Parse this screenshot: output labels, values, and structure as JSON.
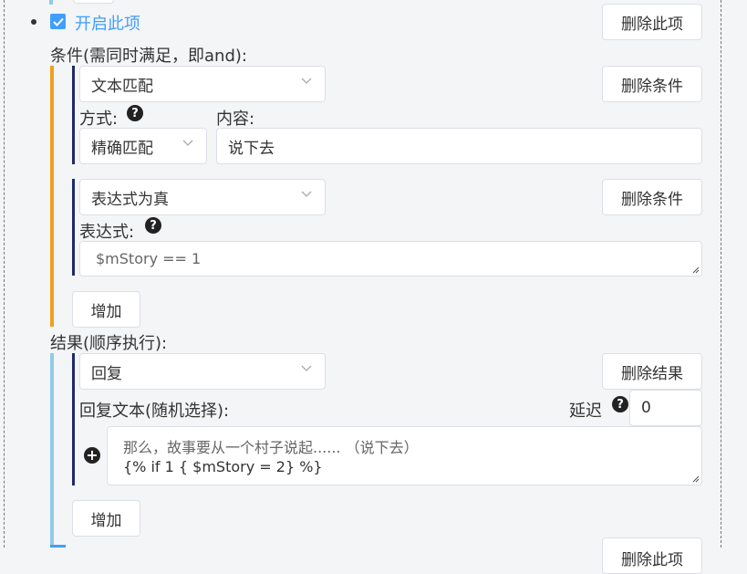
{
  "item": {
    "enable_label": "开启此项",
    "enabled": true,
    "delete_item_label": "删除此项"
  },
  "conditions": {
    "header": "条件(需同时满足，即and):",
    "add_label": "增加",
    "list": [
      {
        "type_value": "文本匹配",
        "delete_label": "删除条件",
        "mode_label": "方式:",
        "mode_value": "精确匹配",
        "content_label": "内容:",
        "content_value": "说下去"
      },
      {
        "type_value": "表达式为真",
        "delete_label": "删除条件",
        "expr_label": "表达式:",
        "expr_value": "$mStory == 1"
      }
    ]
  },
  "results": {
    "header": "结果(顺序执行):",
    "add_label": "增加",
    "list": [
      {
        "type_value": "回复",
        "delete_label": "删除结果",
        "reply_label": "回复文本(随机选择):",
        "delay_label": "延迟",
        "delay_value": "0",
        "reply_lines": [
          "那么，故事要从一个村子说起...... （说下去）",
          "{% if 1 { $mStory = 2} %}"
        ]
      }
    ]
  },
  "next_item": {
    "delete_item_label": "删除此项"
  },
  "colors": {
    "accent": "#409eff",
    "condition_bar": "#f0a020",
    "result_bar": "#8fcce8",
    "inner_bar": "#1f2a6b"
  }
}
